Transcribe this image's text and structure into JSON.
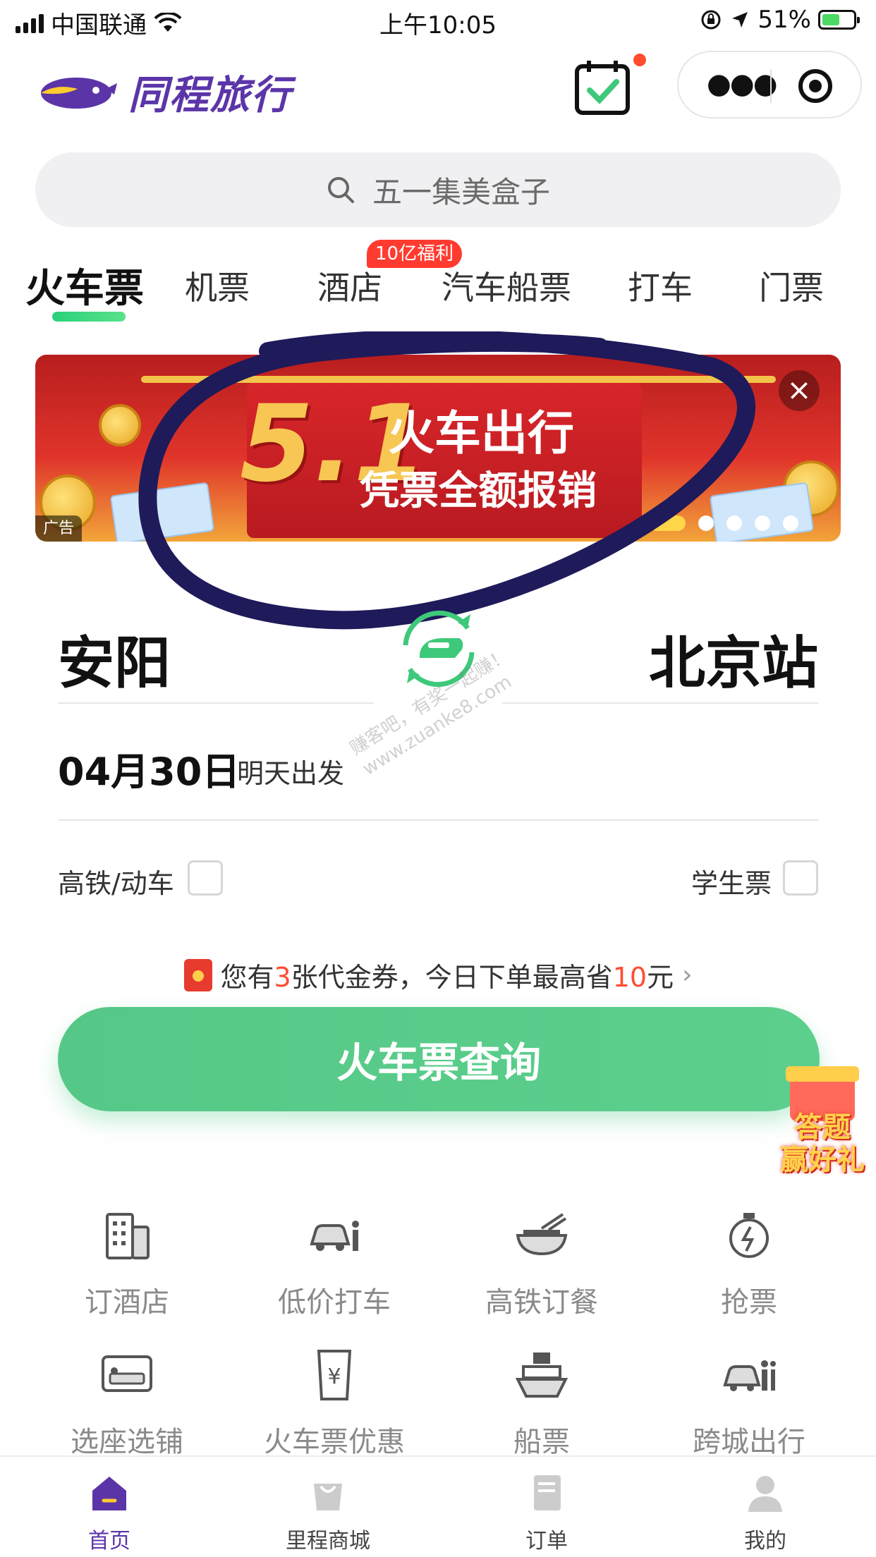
{
  "status_bar": {
    "carrier": "中国联通",
    "time": "上午10:05",
    "battery": "51%"
  },
  "header": {
    "brand": "同程旅行"
  },
  "search": {
    "placeholder": "五一集美盒子"
  },
  "tabs": [
    {
      "label": "火车票",
      "active": true
    },
    {
      "label": "机票"
    },
    {
      "label": "酒店",
      "badge": "10亿福利"
    },
    {
      "label": "汽车船票"
    },
    {
      "label": "打车"
    },
    {
      "label": "门票"
    }
  ],
  "banner": {
    "big": "5.1",
    "line1": "火车出行",
    "line2": "凭票全额报销",
    "ad_tag": "广告",
    "close": "×"
  },
  "route": {
    "from": "安阳",
    "to": "北京站",
    "date": "04月30日",
    "date_note": "明天出发"
  },
  "options": {
    "high_speed": "高铁/动车",
    "student": "学生票"
  },
  "coupon": {
    "prefix": "您有",
    "count": "3",
    "middle": "张代金券，今日下单最高省",
    "amount": "10",
    "suffix": "元",
    "chevron": "›"
  },
  "query_button": "火车票查询",
  "quiz": {
    "line1": "答题",
    "line2": "赢好礼"
  },
  "services": [
    {
      "label": "订酒店",
      "icon": "hotel-icon"
    },
    {
      "label": "低价打车",
      "icon": "taxi-icon"
    },
    {
      "label": "高铁订餐",
      "icon": "meal-icon"
    },
    {
      "label": "抢票",
      "icon": "stopwatch-icon"
    },
    {
      "label": "选座选铺",
      "icon": "seat-icon"
    },
    {
      "label": "火车票优惠",
      "icon": "coupon-icon"
    },
    {
      "label": "船票",
      "icon": "ship-icon"
    },
    {
      "label": "跨城出行",
      "icon": "intercity-icon"
    }
  ],
  "bottom_nav": [
    {
      "label": "首页",
      "active": true
    },
    {
      "label": "里程商城"
    },
    {
      "label": "订单"
    },
    {
      "label": "我的"
    }
  ],
  "watermark": {
    "line1": "赚客吧，有奖一起赚！",
    "line2": "www.zuanke8.com"
  },
  "colors": {
    "brand_purple": "#5b35a8",
    "primary_green": "#5dcf8d",
    "accent_red": "#ff4d33"
  }
}
